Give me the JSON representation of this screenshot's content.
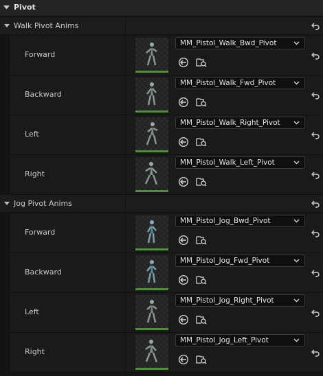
{
  "category": {
    "title": "Pivot"
  },
  "groups": [
    {
      "title": "Walk Pivot Anims",
      "rows": [
        {
          "label": "Forward",
          "asset": "MM_Pistol_Walk_Bwd_Pivot"
        },
        {
          "label": "Backward",
          "asset": "MM_Pistol_Walk_Fwd_Pivot"
        },
        {
          "label": "Left",
          "asset": "MM_Pistol_Walk_Right_Pivot"
        },
        {
          "label": "Right",
          "asset": "MM_Pistol_Walk_Left_Pivot"
        }
      ]
    },
    {
      "title": "Jog Pivot Anims",
      "rows": [
        {
          "label": "Forward",
          "asset": "MM_Pistol_Jog_Bwd_Pivot"
        },
        {
          "label": "Backward",
          "asset": "MM_Pistol_Jog_Fwd_Pivot"
        },
        {
          "label": "Left",
          "asset": "MM_Pistol_Jog_Right_Pivot"
        },
        {
          "label": "Right",
          "asset": "MM_Pistol_Jog_Left_Pivot"
        }
      ]
    }
  ],
  "icons": {
    "expand": "triangle-down-icon",
    "reset": "reset-to-default-icon",
    "use_selected": "use-selected-asset-icon",
    "browse": "browse-to-asset-icon",
    "combo_arrow": "chevron-down-icon"
  },
  "colors": {
    "thumb_underline": "#4f8f3a",
    "background": "#151515"
  }
}
